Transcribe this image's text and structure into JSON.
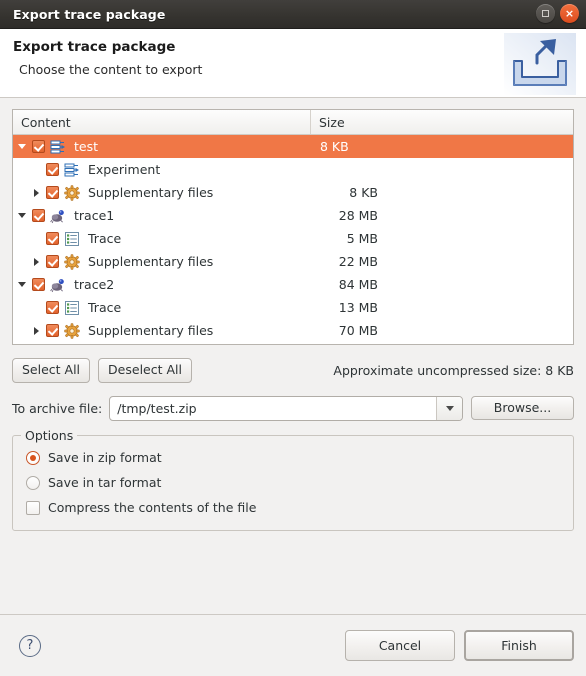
{
  "window": {
    "title": "Export trace package",
    "maximize_label": "Maximize",
    "close_label": "×"
  },
  "banner": {
    "title": "Export trace package",
    "subtitle": "Choose the content to export",
    "icon": "export-tray-icon"
  },
  "tree": {
    "columns": [
      "Content",
      "Size"
    ],
    "rows": [
      {
        "label": "test",
        "size": "8 KB",
        "icon": "experiment-list-icon",
        "depth": 0,
        "twisty": "down",
        "checked": true,
        "selected": true
      },
      {
        "label": "Experiment",
        "size": "",
        "icon": "experiment-list-icon",
        "depth": 1,
        "twisty": "none",
        "checked": true,
        "selected": false
      },
      {
        "label": "Supplementary files",
        "size": "8 KB",
        "icon": "gear-icon",
        "depth": 1,
        "twisty": "right",
        "checked": true,
        "selected": false
      },
      {
        "label": "trace1",
        "size": "28 MB",
        "icon": "trace-bug-icon",
        "depth": 0,
        "twisty": "down",
        "checked": true,
        "selected": false
      },
      {
        "label": "Trace",
        "size": "5 MB",
        "icon": "trace-document-icon",
        "depth": 1,
        "twisty": "none",
        "checked": true,
        "selected": false
      },
      {
        "label": "Supplementary files",
        "size": "22 MB",
        "icon": "gear-icon",
        "depth": 1,
        "twisty": "right",
        "checked": true,
        "selected": false
      },
      {
        "label": "trace2",
        "size": "84 MB",
        "icon": "trace-bug-icon",
        "depth": 0,
        "twisty": "down",
        "checked": true,
        "selected": false
      },
      {
        "label": "Trace",
        "size": "13 MB",
        "icon": "trace-document-icon",
        "depth": 1,
        "twisty": "none",
        "checked": true,
        "selected": false
      },
      {
        "label": "Supplementary files",
        "size": "70 MB",
        "icon": "gear-icon",
        "depth": 1,
        "twisty": "right",
        "checked": true,
        "selected": false
      }
    ]
  },
  "selection_bar": {
    "select_all": "Select All",
    "deselect_all": "Deselect All",
    "approx_size": "Approximate uncompressed size: 8 KB"
  },
  "archive": {
    "label": "To archive file:",
    "value": "/tmp/test.zip",
    "placeholder": "",
    "dropdown_icon": "chevron-down-icon",
    "browse": "Browse..."
  },
  "options": {
    "legend": "Options",
    "items": [
      {
        "label": "Save in zip format",
        "type": "radio",
        "checked": true
      },
      {
        "label": "Save in tar format",
        "type": "radio",
        "checked": false
      },
      {
        "label": "Compress the contents of the file",
        "type": "checkbox",
        "checked": false
      }
    ]
  },
  "footer": {
    "help_icon": "?",
    "cancel": "Cancel",
    "finish": "Finish"
  },
  "colors": {
    "selection": "#f07746",
    "checkbox": "#e2622c",
    "titlebar": "#35332f",
    "close_button": "#e2551f"
  }
}
